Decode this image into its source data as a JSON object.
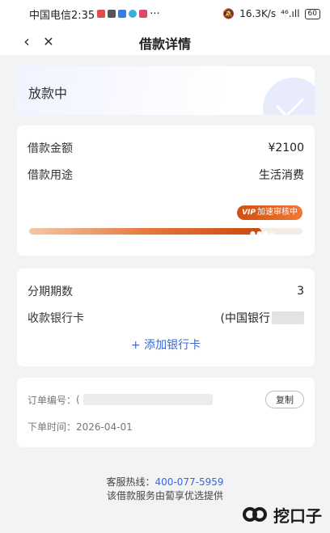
{
  "status_bar": {
    "carrier_time": "中国电信2:35",
    "more": "···",
    "speed": "16.3K/s",
    "signal": "⁴⁶.ıll",
    "battery": "60"
  },
  "nav": {
    "back_icon": "‹",
    "close_icon": "✕",
    "title": "借款详情"
  },
  "loan_status": {
    "text": "放款中"
  },
  "amount_card": {
    "amount_label": "借款金额",
    "amount_value": "¥2100",
    "purpose_label": "借款用途",
    "purpose_value": "生活消费",
    "badge_vip": "VIP",
    "badge_text": "加速审核中",
    "progress_fraction": 0.85
  },
  "install_card": {
    "periods_label": "分期期数",
    "periods_value": "3",
    "bank_label": "收款银行卡",
    "bank_value": "(中国银行",
    "add_bank": "+ 添加银行卡"
  },
  "order_card": {
    "order_no_label": "订单编号：",
    "order_no_value": "(",
    "copy_label": "复制",
    "order_time_label": "下单时间：",
    "order_time_value": "2026-04-01"
  },
  "footer": {
    "hotline_label": "客服热线：",
    "hotline_number": "400-077-5959",
    "provider": "该借款服务由蔔享优选提供"
  },
  "watermark": {
    "text": "挖口子"
  },
  "colors": {
    "accent": "#3a67d8",
    "progress": "#e8793c"
  }
}
